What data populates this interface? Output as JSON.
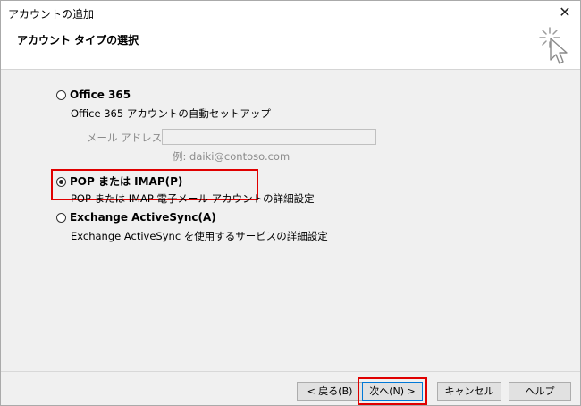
{
  "window": {
    "title": "アカウントの追加",
    "close_glyph": "✕"
  },
  "header": {
    "title": "アカウント タイプの選択",
    "icon": "wizard-cursor-icon"
  },
  "options": {
    "office365": {
      "label": "Office 365",
      "description": "Office 365 アカウントの自動セットアップ",
      "selected": false
    },
    "email": {
      "label": "メール アドレス(E):",
      "value": "",
      "example": "例: daiki@contoso.com"
    },
    "pop_imap": {
      "label": "POP または IMAP(P)",
      "description": "POP または IMAP 電子メール アカウントの詳細設定",
      "selected": true
    },
    "exchange": {
      "label": "Exchange ActiveSync(A)",
      "description": "Exchange ActiveSync を使用するサービスの詳細設定",
      "selected": false
    }
  },
  "buttons": {
    "back": "< 戻る(B)",
    "next": "次へ(N) >",
    "cancel": "キャンセル",
    "help": "ヘルプ"
  },
  "colors": {
    "highlight": "#e00000",
    "focus": "#0078d7"
  }
}
